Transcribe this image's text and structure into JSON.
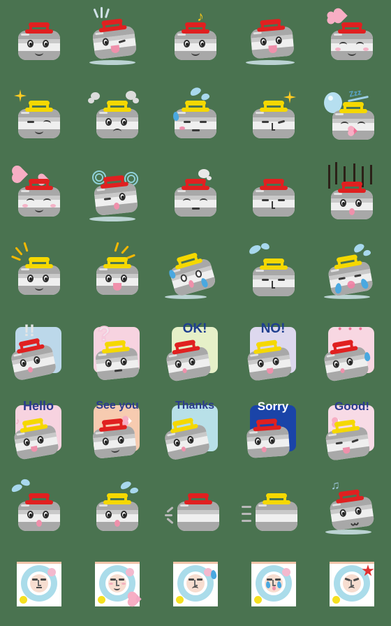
{
  "sheet": {
    "title": "Curling Stone Emoji Sheet",
    "background_color": "#4a7350",
    "columns": 5,
    "rows": 8,
    "cell_size": 112,
    "palette": {
      "stone_body": "#d9d9d9",
      "stone_band_dark": "#a8a8a8",
      "stone_band_light": "#efefef",
      "handle_red": "#e02020",
      "handle_yellow": "#f5d800",
      "text_blue": "#2b3b8f",
      "cheek_pink": "#f6a8bf",
      "water_blue": "#4aa8e0",
      "house_ring": "#aadcea",
      "face_skin": "#f7ddd0"
    }
  },
  "emojis": [
    {
      "index": 1,
      "row": 1,
      "col": 1,
      "name": "stone-smile-red",
      "handle": "red",
      "expression": "smiling",
      "effects": []
    },
    {
      "index": 2,
      "row": 1,
      "col": 2,
      "name": "stone-wink-tongue-red",
      "handle": "red",
      "expression": "winking with tongue out",
      "effects": [
        "impact-lines",
        "ice-sheen"
      ]
    },
    {
      "index": 3,
      "row": 1,
      "col": 3,
      "name": "stone-music-note-red",
      "handle": "red",
      "expression": "happy",
      "effects": [
        "music-note"
      ]
    },
    {
      "index": 4,
      "row": 1,
      "col": 4,
      "name": "stone-open-smile-red",
      "handle": "red",
      "expression": "big open smile",
      "effects": [
        "ice-sheen"
      ]
    },
    {
      "index": 5,
      "row": 1,
      "col": 5,
      "name": "stone-love-hearts-red",
      "handle": "red",
      "expression": "blissful closed eyes",
      "effects": [
        "hearts"
      ]
    },
    {
      "index": 6,
      "row": 2,
      "col": 1,
      "name": "stone-sparkle-smirk-yellow",
      "handle": "yellow",
      "expression": "confident smirk",
      "effects": [
        "sparkle"
      ]
    },
    {
      "index": 7,
      "row": 2,
      "col": 2,
      "name": "stone-angry-steam-yellow",
      "handle": "yellow",
      "expression": "annoyed frown",
      "effects": [
        "steam-puffs"
      ]
    },
    {
      "index": 8,
      "row": 2,
      "col": 3,
      "name": "stone-sweat-worried-yellow",
      "handle": "yellow",
      "expression": "worried",
      "effects": [
        "sweat-drop",
        "splash"
      ]
    },
    {
      "index": 9,
      "row": 2,
      "col": 4,
      "name": "stone-smug-sparkle-yellow",
      "handle": "yellow",
      "expression": "smug",
      "effects": [
        "sparkle"
      ]
    },
    {
      "index": 10,
      "row": 2,
      "col": 5,
      "name": "stone-sleeping-yellow",
      "handle": "yellow",
      "expression": "sleeping",
      "effects": [
        "sleep-bubble",
        "zzz"
      ],
      "zzz_text": "Zzz"
    },
    {
      "index": 11,
      "row": 3,
      "col": 1,
      "name": "stone-in-love-red",
      "handle": "red",
      "expression": "in love, blushing",
      "effects": [
        "hearts"
      ]
    },
    {
      "index": 12,
      "row": 3,
      "col": 2,
      "name": "stone-dizzy-red",
      "handle": "red",
      "expression": "dizzy spiral eyes",
      "effects": [
        "dizzy-swirls",
        "ice-sheen"
      ]
    },
    {
      "index": 13,
      "row": 3,
      "col": 3,
      "name": "stone-sigh-red",
      "handle": "red",
      "expression": "sighing",
      "effects": [
        "sigh-puff"
      ]
    },
    {
      "index": 14,
      "row": 3,
      "col": 4,
      "name": "stone-blank-red",
      "handle": "red",
      "expression": "blank stare",
      "effects": []
    },
    {
      "index": 15,
      "row": 3,
      "col": 5,
      "name": "stone-despair-red",
      "handle": "red",
      "expression": "shocked despair",
      "effects": [
        "despair-lines"
      ]
    },
    {
      "index": 16,
      "row": 4,
      "col": 1,
      "name": "stone-cheer-smile-yellow",
      "handle": "yellow",
      "expression": "cheerful",
      "effects": [
        "cheer-lines"
      ]
    },
    {
      "index": 17,
      "row": 4,
      "col": 2,
      "name": "stone-cheer-open-yellow",
      "handle": "yellow",
      "expression": "excited open mouth",
      "effects": [
        "cheer-lines"
      ]
    },
    {
      "index": 18,
      "row": 4,
      "col": 3,
      "name": "stone-crying-tilted-yellow",
      "handle": "yellow",
      "expression": "crying",
      "effects": [
        "tears",
        "splash"
      ]
    },
    {
      "index": 19,
      "row": 4,
      "col": 4,
      "name": "stone-tired-yellow",
      "handle": "yellow",
      "expression": "tired",
      "effects": [
        "sweat-splash"
      ]
    },
    {
      "index": 20,
      "row": 4,
      "col": 5,
      "name": "stone-sobbing-tilted-yellow",
      "handle": "yellow",
      "expression": "sobbing",
      "effects": [
        "tears",
        "splash"
      ]
    },
    {
      "index": 21,
      "row": 5,
      "col": 1,
      "name": "card-exclaim-red",
      "handle": "red",
      "expression": "surprised",
      "card_color": "#bcd8ea",
      "card_text": "!!"
    },
    {
      "index": 22,
      "row": 5,
      "col": 2,
      "name": "card-question-yellow",
      "handle": "yellow",
      "expression": "puzzled",
      "card_color": "#f7d3e0",
      "card_text": "?"
    },
    {
      "index": 23,
      "row": 5,
      "col": 3,
      "name": "card-ok-red",
      "handle": "red",
      "expression": "pleased",
      "card_color": "#e6f0c8",
      "card_text": "OK!",
      "text_color": "#1f3f8f"
    },
    {
      "index": 24,
      "row": 5,
      "col": 4,
      "name": "card-no-yellow",
      "handle": "yellow",
      "expression": "refusing",
      "card_color": "#ddd8ee",
      "card_text": "NO!",
      "text_color": "#1f3f8f"
    },
    {
      "index": 25,
      "row": 5,
      "col": 5,
      "name": "card-dots-red",
      "handle": "red",
      "expression": "awkward",
      "card_color": "#f8d7e2",
      "card_text": "• • •"
    },
    {
      "index": 26,
      "row": 6,
      "col": 1,
      "name": "card-hello-yellow",
      "handle": "yellow",
      "expression": "greeting",
      "card_color": "#f7d3e0",
      "card_text": "Hello",
      "text_color": "#2b3b8f"
    },
    {
      "index": 27,
      "row": 6,
      "col": 2,
      "name": "card-see-you-red",
      "handle": "red",
      "expression": "waving off",
      "card_color": "#f7cbb0",
      "card_text": "See you",
      "text_color": "#2b3b8f"
    },
    {
      "index": 28,
      "row": 6,
      "col": 3,
      "name": "card-thanks-yellow",
      "handle": "yellow",
      "expression": "grateful",
      "card_color": "#b8e0e8",
      "card_text": "Thanks",
      "text_color": "#2b3b8f"
    },
    {
      "index": 29,
      "row": 6,
      "col": 4,
      "name": "card-sorry-red",
      "handle": "red",
      "expression": "apologetic",
      "card_color": "#1a44a8",
      "card_text": "Sorry",
      "text_color": "#ffffff"
    },
    {
      "index": 30,
      "row": 6,
      "col": 5,
      "name": "card-good-yellow",
      "handle": "yellow",
      "expression": "satisfied",
      "card_color": "#f8dbe6",
      "card_text": "Good!",
      "text_color": "#2b3b8f"
    },
    {
      "index": 31,
      "row": 7,
      "col": 1,
      "name": "stone-shocked-sweat-red",
      "handle": "red",
      "expression": "shocked",
      "effects": [
        "sweat-drops"
      ]
    },
    {
      "index": 32,
      "row": 7,
      "col": 2,
      "name": "stone-shocked-sweat-yellow",
      "handle": "yellow",
      "expression": "shocked",
      "effects": [
        "sweat-drops"
      ]
    },
    {
      "index": 33,
      "row": 7,
      "col": 3,
      "name": "stone-sliding-red",
      "handle": "red",
      "expression": "none, sliding",
      "effects": [
        "motion-lines"
      ]
    },
    {
      "index": 34,
      "row": 7,
      "col": 4,
      "name": "stone-sliding-yellow",
      "handle": "yellow",
      "expression": "none, sliding",
      "effects": [
        "motion-lines"
      ]
    },
    {
      "index": 35,
      "row": 7,
      "col": 5,
      "name": "stone-humming-red",
      "handle": "red",
      "expression": "humming",
      "effects": [
        "music-note",
        "ice-sheen"
      ]
    },
    {
      "index": 36,
      "row": 8,
      "col": 1,
      "name": "house-face-neutral",
      "house": true,
      "expression": "neutral"
    },
    {
      "index": 37,
      "row": 8,
      "col": 2,
      "name": "house-face-smile-heart",
      "house": true,
      "expression": "smiling",
      "effects": [
        "heart"
      ]
    },
    {
      "index": 38,
      "row": 8,
      "col": 3,
      "name": "house-face-sweat",
      "house": true,
      "expression": "worried",
      "effects": [
        "sweat-drop"
      ]
    },
    {
      "index": 39,
      "row": 8,
      "col": 4,
      "name": "house-face-crying",
      "house": true,
      "expression": "crying",
      "effects": [
        "tears"
      ]
    },
    {
      "index": 40,
      "row": 8,
      "col": 5,
      "name": "house-face-angry",
      "house": true,
      "expression": "angry",
      "effects": [
        "anger-star"
      ]
    }
  ]
}
